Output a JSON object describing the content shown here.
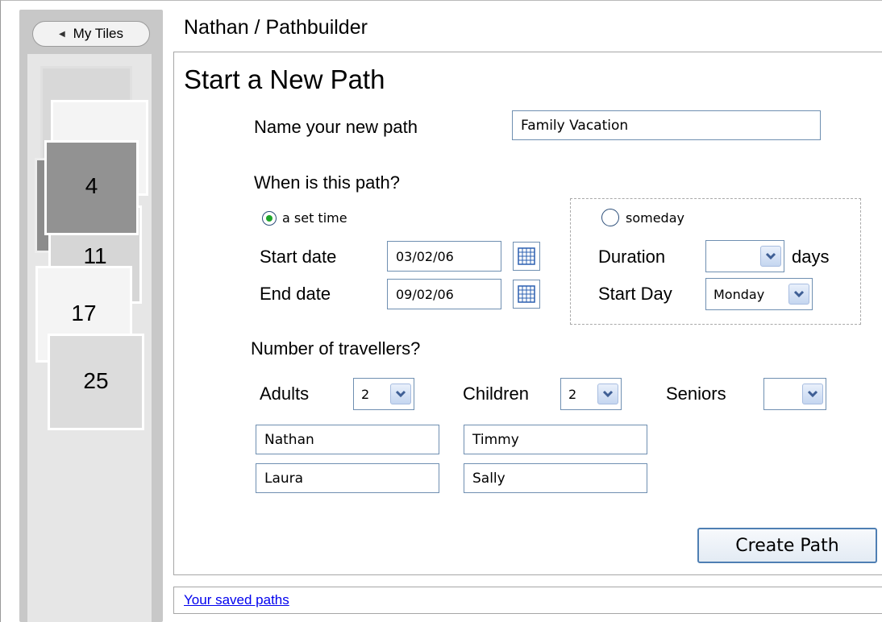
{
  "sidebar": {
    "back_button_label": "My Tiles",
    "tiles": [
      {
        "label": "",
        "id": "a"
      },
      {
        "label": "",
        "id": "b"
      },
      {
        "label": "4",
        "id": "c"
      },
      {
        "label": "11",
        "id": "d"
      },
      {
        "label": "17",
        "id": "e"
      },
      {
        "label": "25",
        "id": "f"
      }
    ]
  },
  "header": {
    "breadcrumb": "Nathan / Pathbuilder"
  },
  "form": {
    "title": "Start a New Path",
    "name_label": "Name your new path",
    "name_value": "Family Vacation",
    "when_label": "When is this path?",
    "set_time_label": "a set time",
    "someday_label": "someday",
    "start_date_label": "Start date",
    "start_date_value": "03/02/06",
    "end_date_label": "End date",
    "end_date_value": "09/02/06",
    "duration_label": "Duration",
    "duration_value": "",
    "days_label": "days",
    "start_day_label": "Start Day",
    "start_day_value": "Monday",
    "travellers_label": "Number of travellers?",
    "adults_label": "Adults",
    "adults_value": "2",
    "children_label": "Children",
    "children_value": "2",
    "seniors_label": "Seniors",
    "seniors_value": "",
    "adult_names": [
      "Nathan",
      "Laura"
    ],
    "child_names": [
      "Timmy",
      "Sally"
    ],
    "create_button": "Create Path"
  },
  "footer": {
    "saved_paths_link": "Your saved paths"
  },
  "colors": {
    "accent": "#6f8fb1",
    "radio_selected": "#1ea52b",
    "link": "#0000ee"
  }
}
